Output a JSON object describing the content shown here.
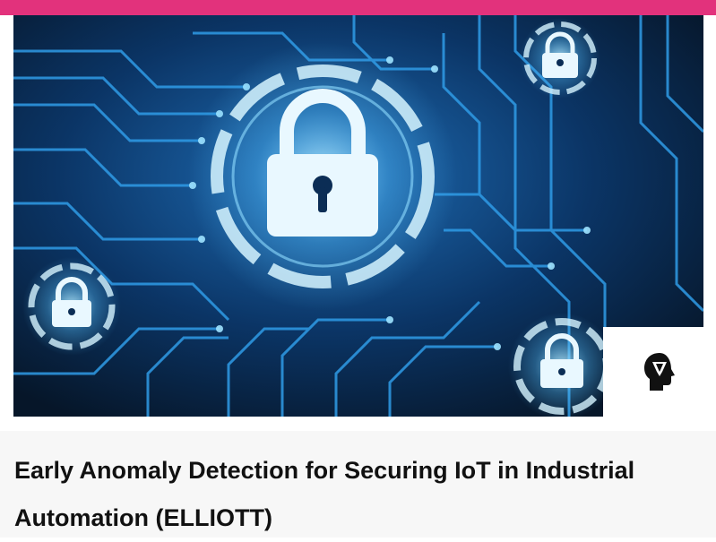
{
  "header": {
    "accent_color": "#e2327c"
  },
  "hero": {
    "image_icon": "padlock-circuit-board-image",
    "colors": {
      "background": "#071a33",
      "circuit": "#2f9be6",
      "glow": "#9fe3ff",
      "lock": "#e9f8ff"
    }
  },
  "logo": {
    "icon": "head-silhouette-icon"
  },
  "article": {
    "title": "Early Anomaly Detection for Securing IoT in Industrial Automation (ELLIOTT)"
  }
}
